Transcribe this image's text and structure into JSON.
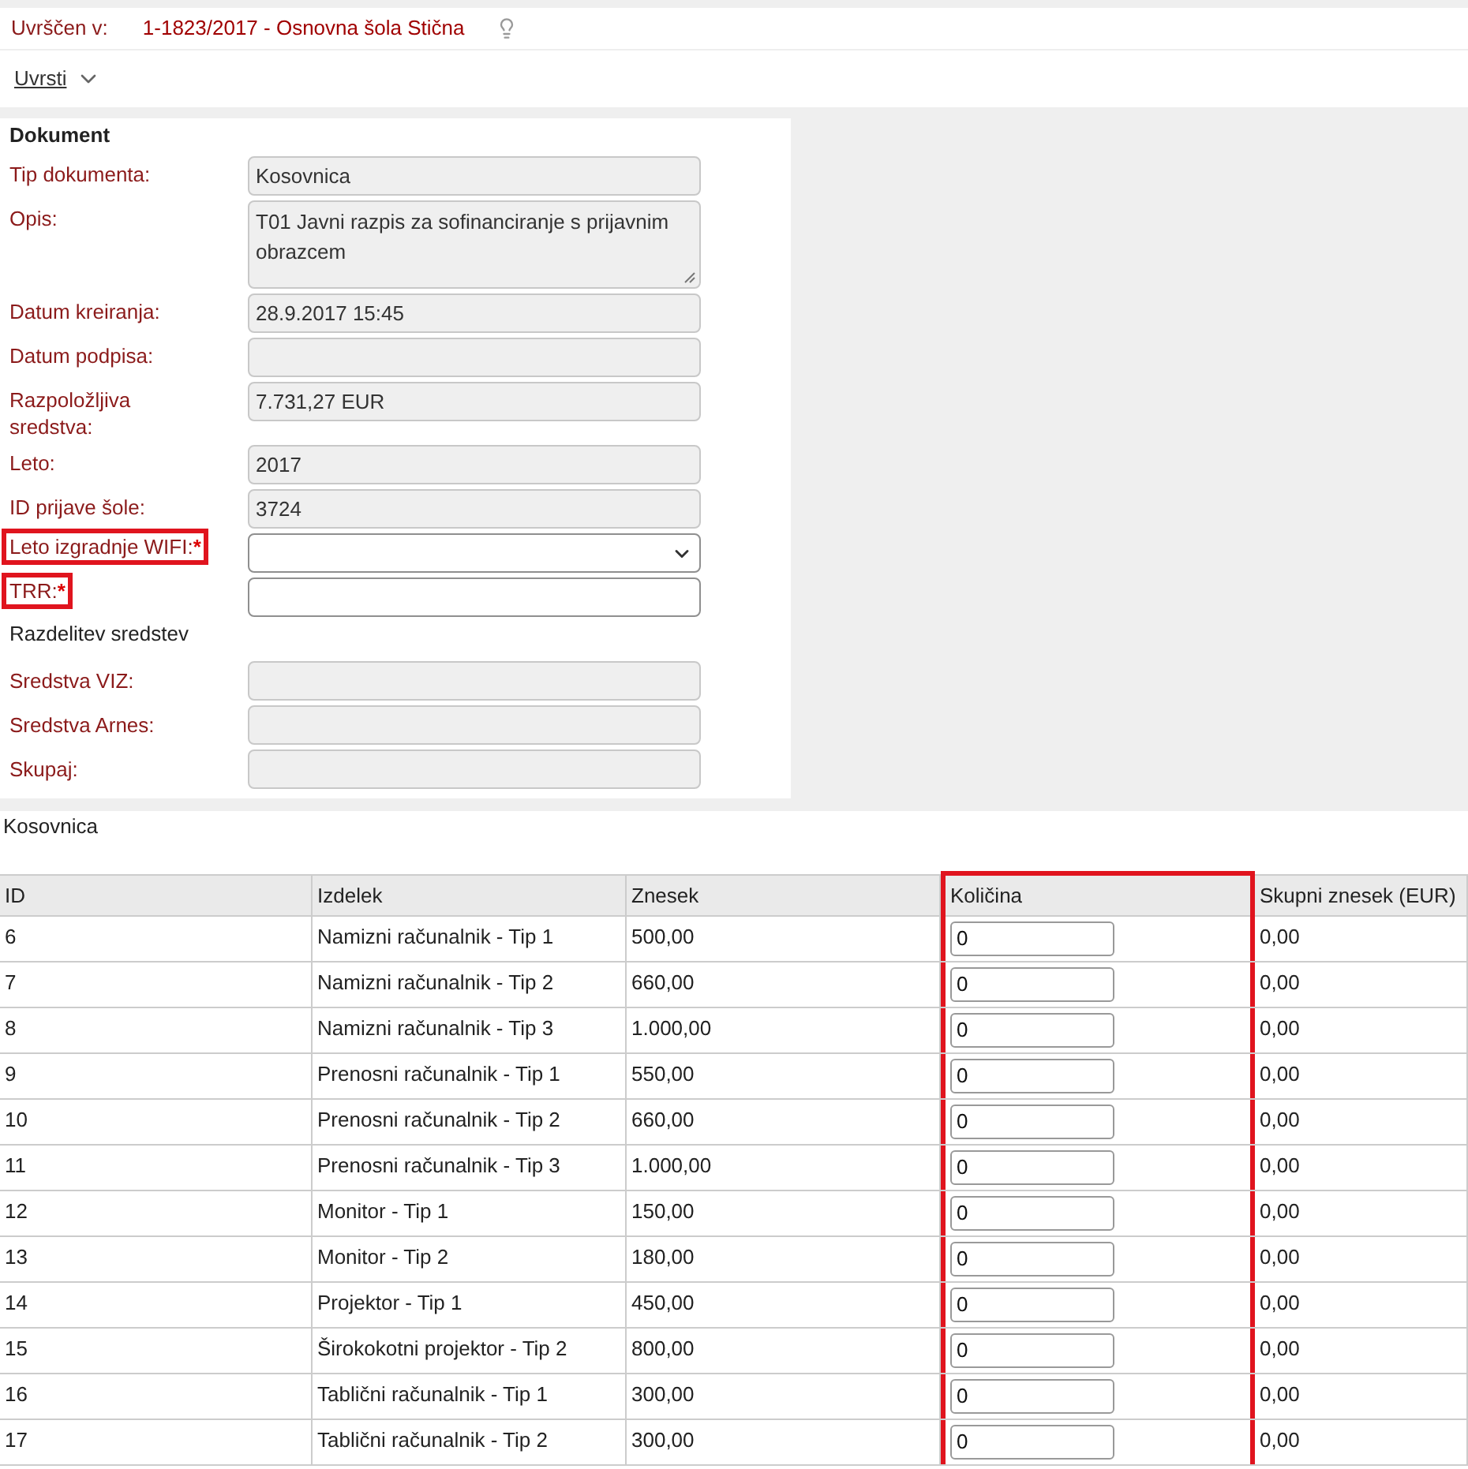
{
  "header": {
    "label": "Uvrščen v:",
    "value": "1-1823/2017 - Osnovna šola Stična"
  },
  "action": {
    "label": "Uvrsti"
  },
  "document": {
    "title": "Dokument",
    "fields": [
      {
        "label": "Tip dokumenta:",
        "kind": "text",
        "value": "Kosovnica",
        "disabled": true,
        "required": false,
        "highlighted": false
      },
      {
        "label": "Opis:",
        "kind": "textarea",
        "value": "T01 Javni razpis za sofinanciranje s prijavnim obrazcem",
        "disabled": true,
        "required": false,
        "highlighted": false
      },
      {
        "label": "Datum kreiranja:",
        "kind": "text",
        "value": "28.9.2017 15:45",
        "disabled": true,
        "required": false,
        "highlighted": false
      },
      {
        "label": "Datum podpisa:",
        "kind": "text",
        "disabled": true,
        "required": false,
        "highlighted": false
      },
      {
        "label": "Razpoložljiva sredstva:",
        "kind": "text",
        "value": "7.731,27 EUR",
        "disabled": true,
        "required": false,
        "highlighted": false
      },
      {
        "label": "Leto:",
        "kind": "text",
        "value": "2017",
        "disabled": true,
        "required": false,
        "highlighted": false
      },
      {
        "label": "ID prijave šole:",
        "kind": "text",
        "value": "3724",
        "disabled": true,
        "required": false,
        "highlighted": false
      },
      {
        "label": "Leto izgradnje WIFI:",
        "kind": "select",
        "disabled": false,
        "required": true,
        "highlighted": true
      },
      {
        "label": "TRR:",
        "kind": "text",
        "disabled": false,
        "required": true,
        "highlighted": true
      }
    ],
    "required_mark": "*",
    "section": "Razdelitev sredstev",
    "section_fields": [
      {
        "label": "Sredstva VIZ:",
        "disabled": true
      },
      {
        "label": "Sredstva Arnes:",
        "disabled": true
      },
      {
        "label": "Skupaj:",
        "disabled": true
      }
    ]
  },
  "table": {
    "title": "Kosovnica",
    "columns": [
      {
        "label": "ID",
        "highlighted": false
      },
      {
        "label": "Izdelek",
        "highlighted": false
      },
      {
        "label": "Znesek",
        "highlighted": false
      },
      {
        "label": "Količina",
        "highlighted": true
      },
      {
        "label": "Skupni znesek (EUR)",
        "highlighted": false
      }
    ],
    "rows": [
      {
        "id": "6",
        "product": "Namizni računalnik - Tip 1",
        "amount": "500,00",
        "quantity": "0",
        "total": "0,00"
      },
      {
        "id": "7",
        "product": "Namizni računalnik - Tip 2",
        "amount": "660,00",
        "quantity": "0",
        "total": "0,00"
      },
      {
        "id": "8",
        "product": "Namizni računalnik - Tip 3",
        "amount": "1.000,00",
        "quantity": "0",
        "total": "0,00"
      },
      {
        "id": "9",
        "product": "Prenosni računalnik - Tip 1",
        "amount": "550,00",
        "quantity": "0",
        "total": "0,00"
      },
      {
        "id": "10",
        "product": "Prenosni računalnik - Tip 2",
        "amount": "660,00",
        "quantity": "0",
        "total": "0,00"
      },
      {
        "id": "11",
        "product": "Prenosni računalnik - Tip 3",
        "amount": "1.000,00",
        "quantity": "0",
        "total": "0,00"
      },
      {
        "id": "12",
        "product": "Monitor - Tip 1",
        "amount": "150,00",
        "quantity": "0",
        "total": "0,00"
      },
      {
        "id": "13",
        "product": "Monitor - Tip 2",
        "amount": "180,00",
        "quantity": "0",
        "total": "0,00"
      },
      {
        "id": "14",
        "product": "Projektor - Tip 1",
        "amount": "450,00",
        "quantity": "0",
        "total": "0,00"
      },
      {
        "id": "15",
        "product": "Širokokotni projektor - Tip 2",
        "amount": "800,00",
        "quantity": "0",
        "total": "0,00"
      },
      {
        "id": "16",
        "product": "Tablični računalnik - Tip 1",
        "amount": "300,00",
        "quantity": "0",
        "total": "0,00"
      },
      {
        "id": "17",
        "product": "Tablični računalnik - Tip 2",
        "amount": "300,00",
        "quantity": "0",
        "total": "0,00"
      }
    ]
  }
}
